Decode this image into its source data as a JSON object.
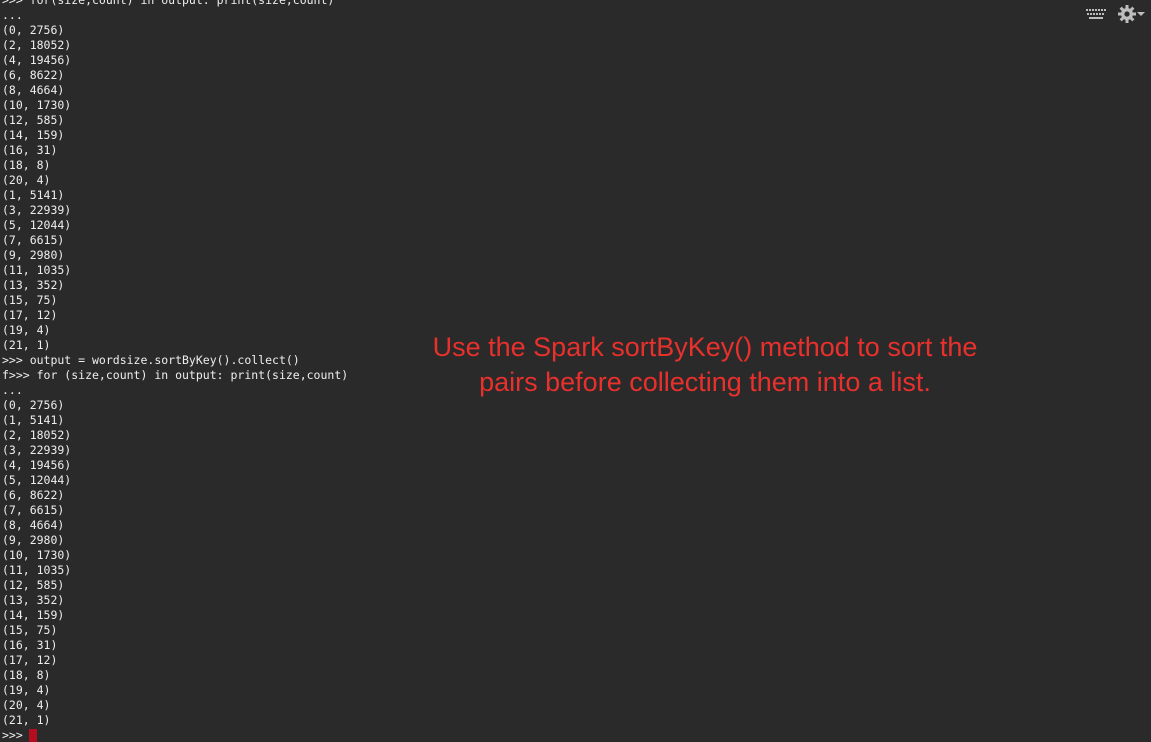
{
  "terminal": {
    "lines": [
      ">>> for(size,count) in output: print(size,count)",
      "...",
      "(0, 2756)",
      "(2, 18052)",
      "(4, 19456)",
      "(6, 8622)",
      "(8, 4664)",
      "(10, 1730)",
      "(12, 585)",
      "(14, 159)",
      "(16, 31)",
      "(18, 8)",
      "(20, 4)",
      "(1, 5141)",
      "(3, 22939)",
      "(5, 12044)",
      "(7, 6615)",
      "(9, 2980)",
      "(11, 1035)",
      "(13, 352)",
      "(15, 75)",
      "(17, 12)",
      "(19, 4)",
      "(21, 1)",
      ">>> output = wordsize.sortByKey().collect()",
      "f>>> for (size,count) in output: print(size,count)",
      "...",
      "(0, 2756)",
      "(1, 5141)",
      "(2, 18052)",
      "(3, 22939)",
      "(4, 19456)",
      "(5, 12044)",
      "(6, 8622)",
      "(7, 6615)",
      "(8, 4664)",
      "(9, 2980)",
      "(10, 1730)",
      "(11, 1035)",
      "(12, 585)",
      "(13, 352)",
      "(14, 159)",
      "(15, 75)",
      "(16, 31)",
      "(17, 12)",
      "(18, 8)",
      "(19, 4)",
      "(20, 4)",
      "(21, 1)"
    ],
    "prompt": ">>>"
  },
  "annotation": {
    "line1": "Use the Spark sortByKey() method to sort the",
    "line2": "pairs before collecting them into a list.",
    "color": "#e8302c"
  },
  "toolbar": {
    "keyboard_icon": "keyboard-icon",
    "settings_icon": "gear-icon",
    "dropdown_icon": "chevron-down-icon"
  },
  "colors": {
    "background": "#2a2a2a",
    "text": "#eeeeee",
    "cursor": "#b40d1e"
  }
}
